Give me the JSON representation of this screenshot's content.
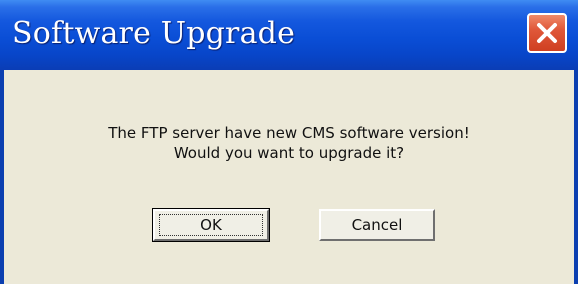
{
  "window": {
    "title": "Software Upgrade",
    "close_icon": "close-icon"
  },
  "message": {
    "line1": "The FTP server have new CMS software version!",
    "line2": "Would you want to upgrade it?"
  },
  "buttons": {
    "ok_label": "OK",
    "cancel_label": "Cancel"
  },
  "colors": {
    "titlebar": "#0a4ed6",
    "close_button": "#e0583a",
    "dialog_background": "#ece9d8"
  }
}
